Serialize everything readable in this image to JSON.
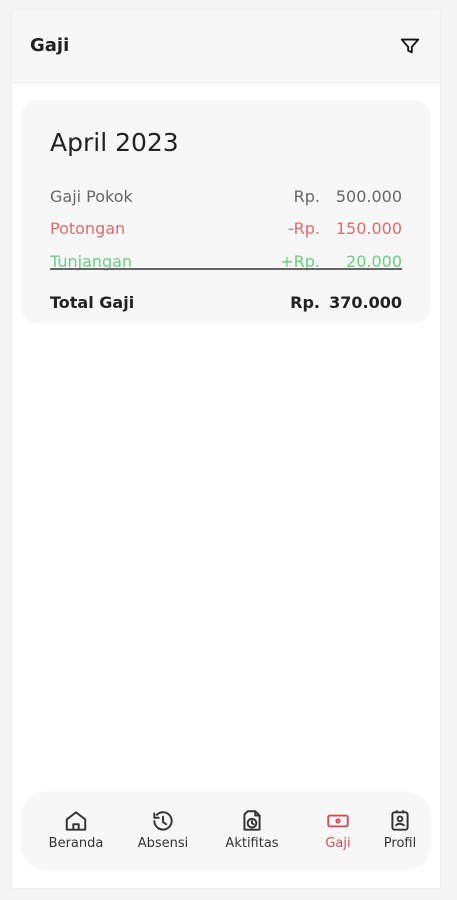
{
  "header": {
    "title": "Gaji"
  },
  "summary": {
    "month": "April 2023",
    "rows": [
      {
        "label": "Gaji Pokok",
        "currency": "Rp.",
        "amount": "500.000"
      },
      {
        "label": "Potongan",
        "currency": "-Rp.",
        "amount": "150.000"
      },
      {
        "label": "Tunjangan",
        "currency": "+Rp.",
        "amount": "20.000"
      }
    ],
    "total": {
      "label": "Total Gaji",
      "currency": "Rp.",
      "amount": "370.000"
    }
  },
  "nav": {
    "items": [
      {
        "label": "Beranda",
        "icon": "home-icon"
      },
      {
        "label": "Absensi",
        "icon": "history-icon"
      },
      {
        "label": "Aktifitas",
        "icon": "document-clock-icon"
      },
      {
        "label": "Gaji",
        "icon": "money-icon"
      },
      {
        "label": "Profil",
        "icon": "profile-card-icon"
      }
    ]
  },
  "colors": {
    "accent": "#d14d54",
    "deduction": "#e06a6a",
    "allowance": "#68cf83"
  }
}
